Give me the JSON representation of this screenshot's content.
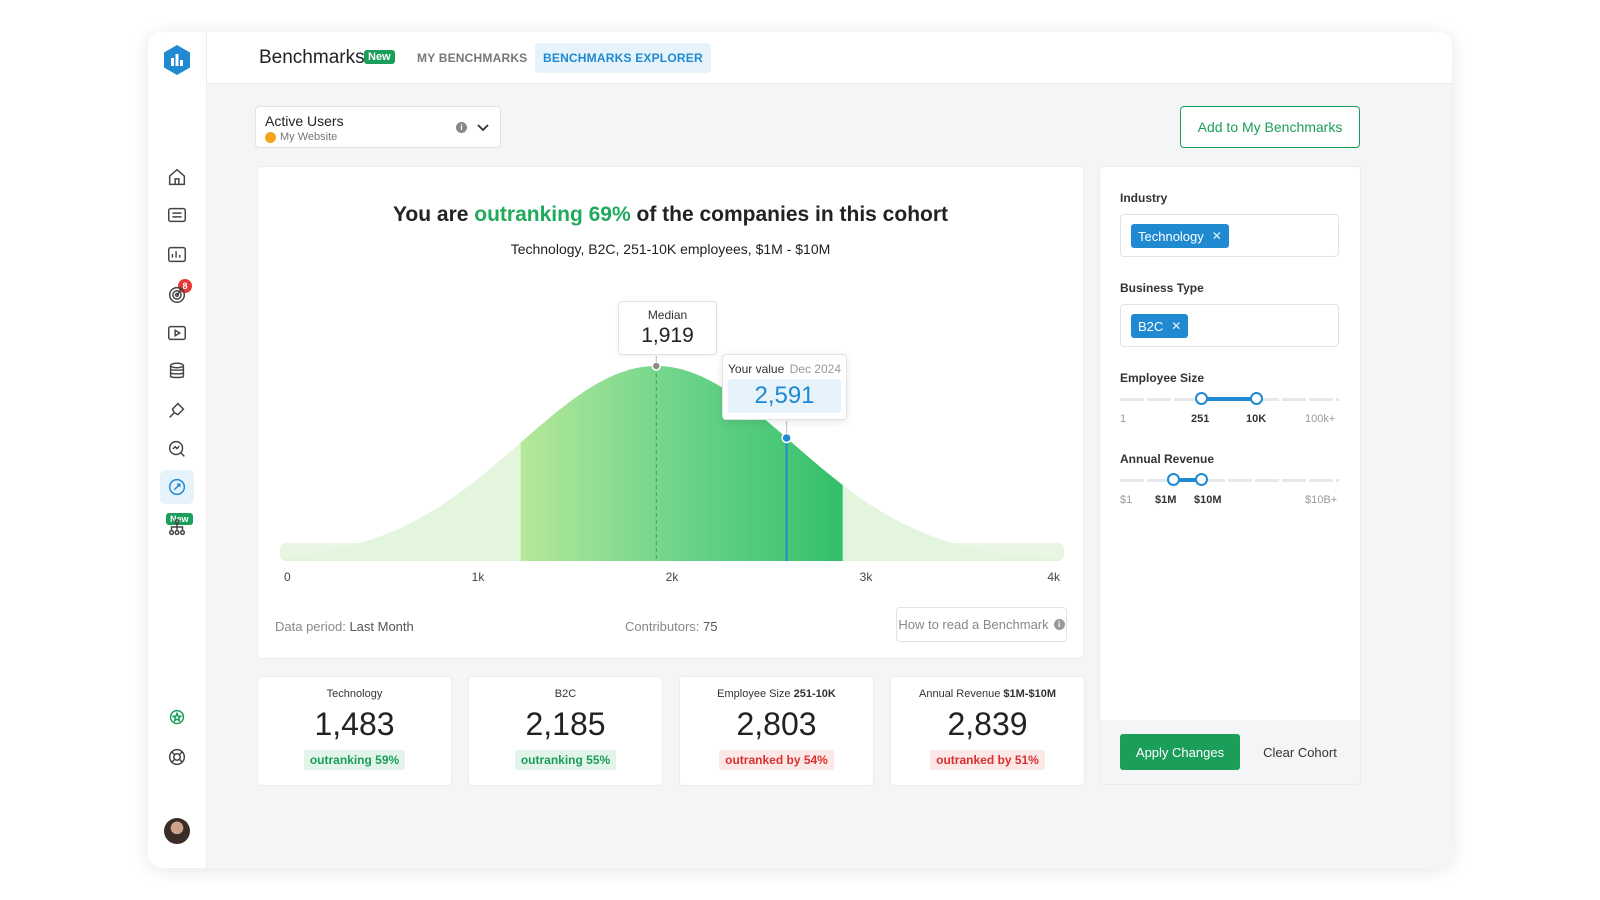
{
  "header": {
    "title": "Benchmarks",
    "new_badge": "New",
    "tabs": [
      {
        "label": "MY BENCHMARKS",
        "active": false
      },
      {
        "label": "BENCHMARKS EXPLORER",
        "active": true
      }
    ]
  },
  "sidebar": {
    "icons": [
      "home-icon",
      "numbers-icon",
      "dashboard-icon",
      "goals-icon",
      "video-icon",
      "database-icon",
      "connect-icon",
      "search-chart-icon",
      "benchmarks-icon",
      "hierarchy-icon",
      "badge-icon",
      "help-icon"
    ],
    "notification_count": "8",
    "new_label": "New"
  },
  "metric_selector": {
    "name": "Active Users",
    "source": "My Website"
  },
  "add_button": "Add to My Benchmarks",
  "headline": {
    "prefix": "You are ",
    "highlight": "outranking 69%",
    "suffix": " of the companies in this cohort"
  },
  "cohort_description": "Technology, B2C, 251-10K employees, $1M - $10M",
  "chart_data": {
    "type": "area",
    "x_range": [
      0,
      4000
    ],
    "x_ticks": [
      "0",
      "1k",
      "2k",
      "3k",
      "4k"
    ],
    "median": {
      "label": "Median",
      "value": 1919,
      "display": "1,919"
    },
    "your_value": {
      "label": "Your value",
      "date": "Dec 2024",
      "value": 2591,
      "display": "2,591"
    },
    "highlight_range": [
      1220,
      2880
    ],
    "distribution": "normal",
    "spread": 700
  },
  "footer": {
    "data_period_label": "Data period: ",
    "data_period": "Last Month",
    "contributors_label": "Contributors: ",
    "contributors": "75",
    "how_to": "How to read a Benchmark"
  },
  "stats": [
    {
      "label": "Technology",
      "label_bold": "",
      "value": "1,483",
      "status": "outranking 59%",
      "positive": true
    },
    {
      "label": "B2C",
      "label_bold": "",
      "value": "2,185",
      "status": "outranking 55%",
      "positive": true
    },
    {
      "label": "Employee Size ",
      "label_bold": "251-10K",
      "value": "2,803",
      "status": "outranked by 54%",
      "positive": false
    },
    {
      "label": "Annual Revenue ",
      "label_bold": "$1M-$10M",
      "value": "2,839",
      "status": "outranked by 51%",
      "positive": false
    }
  ],
  "filters": {
    "industry": {
      "label": "Industry",
      "chip": "Technology"
    },
    "business_type": {
      "label": "Business Type",
      "chip": "B2C"
    },
    "employee_size": {
      "label": "Employee Size",
      "ticks": [
        "1",
        "251",
        "10K",
        "100k+"
      ],
      "selected": [
        "251",
        "10K"
      ]
    },
    "annual_revenue": {
      "label": "Annual Revenue",
      "ticks": [
        "$1",
        "$1M",
        "$10M",
        "$10B+"
      ],
      "selected": [
        "$1M",
        "$10M"
      ]
    },
    "apply": "Apply Changes",
    "clear": "Clear Cohort"
  }
}
